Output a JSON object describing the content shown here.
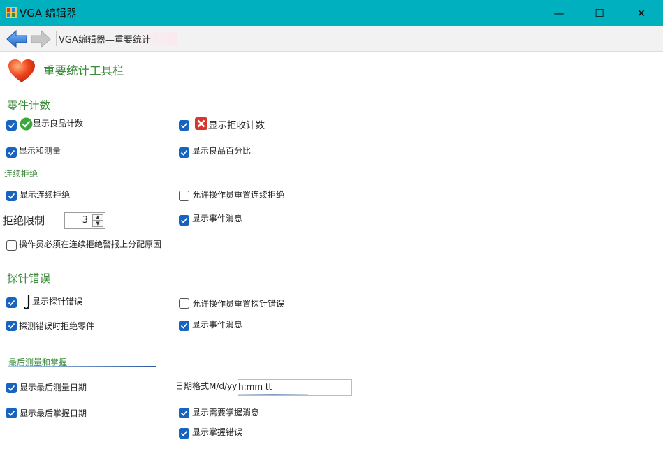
{
  "window": {
    "title": "VGA 编辑器",
    "minimize": "—",
    "maximize": "☐",
    "close": "✕",
    "titlebar_color": "#00b0be"
  },
  "nav": {
    "breadcrumb": "VGA编辑器—重要统计",
    "back_icon": "back-arrow-icon",
    "forward_icon": "forward-arrow-icon"
  },
  "header": {
    "icon": "heart-icon",
    "title": "重要统计工具栏"
  },
  "parts_count": {
    "title": "零件计数",
    "show_good_count": {
      "label": "显示良品计数",
      "checked": true,
      "icon": "green-check-icon"
    },
    "show_reject_count": {
      "label": "显示拒收计数",
      "checked": true,
      "icon": "red-x-icon"
    },
    "show_sum_measure": {
      "label": "显示和测量",
      "checked": true
    },
    "show_good_percent": {
      "label": "显示良品百分比",
      "checked": true
    }
  },
  "consecutive_reject": {
    "title": "连续拒绝",
    "show_consecutive_reject": {
      "label": "显示连续拒绝",
      "checked": true
    },
    "allow_operator_reset": {
      "label": "允许操作员重置连续拒绝",
      "checked": false
    },
    "reject_limit_label": "拒绝限制",
    "reject_limit_value": "3",
    "show_event_message": {
      "label": "显示事件消息",
      "checked": true
    },
    "operator_must_assign": {
      "label": "操作员必须在连续拒绝警报上分配原因",
      "checked": false
    }
  },
  "probe_error": {
    "title": "探针错误",
    "show_probe_error": {
      "label": "显示探针错误",
      "checked": true,
      "icon": "probe-icon"
    },
    "allow_operator_reset": {
      "label": "允许操作员重置探针错误",
      "checked": false
    },
    "reject_on_probe_error": {
      "label": "探测错误时拒绝零件",
      "checked": true
    },
    "show_event_message": {
      "label": "显示事件消息",
      "checked": true
    }
  },
  "last_measure": {
    "title": "最后测量和掌握",
    "show_last_measure_date": {
      "label": "显示最后测量日期",
      "checked": true
    },
    "date_format_label": "日期格式M/d/yy",
    "date_format_value": "h:mm tt",
    "show_last_master_date": {
      "label": "显示最后掌握日期",
      "checked": true
    },
    "show_master_needed_msg": {
      "label": "显示需要掌握消息",
      "checked": true
    },
    "show_master_error": {
      "label": "显示掌握错误",
      "checked": true
    }
  },
  "colors": {
    "accent": "#1764c0",
    "section_green": "#3a8a3a",
    "arrow_blue": "#2f7fd8"
  }
}
